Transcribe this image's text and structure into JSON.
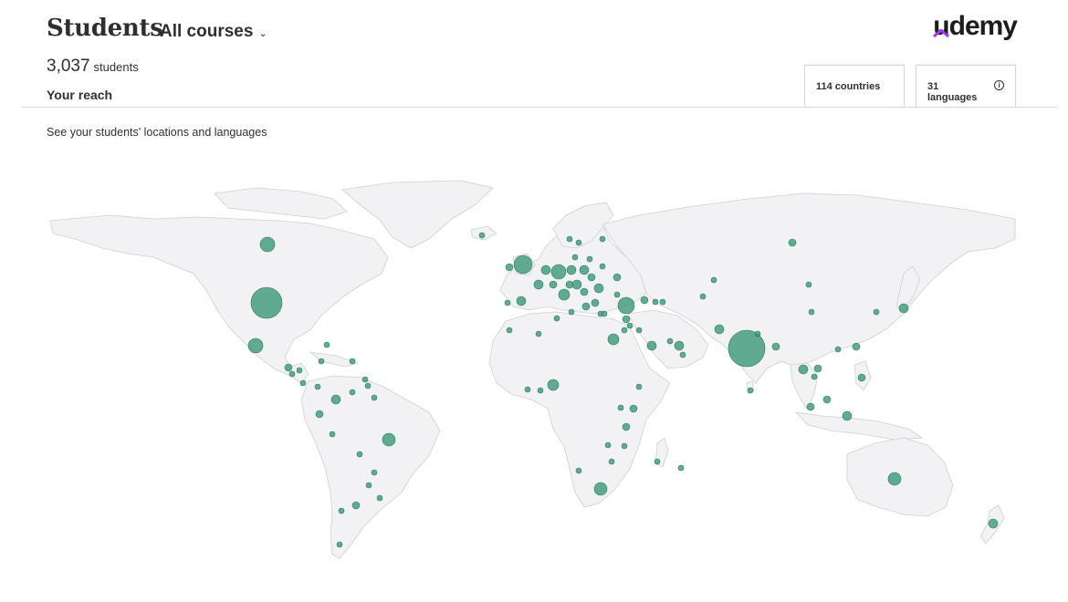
{
  "header": {
    "title": "Students",
    "course_filter": "All courses",
    "logo_text": "udemy"
  },
  "summary": {
    "count": "3,037",
    "unit": "students",
    "section_title": "Your reach"
  },
  "tabs": {
    "countries": "114 countries",
    "languages": "31 languages"
  },
  "subtitle": "See your students' locations and languages",
  "colors": {
    "bubble": "#3f9a7c",
    "land": "#f2f2f4",
    "brand_purple": "#a435f0"
  },
  "icons": {
    "course_filter": "chevron-down-icon",
    "languages_info": "info-circle-icon",
    "logo_mark": "udemy-hat-icon"
  }
}
